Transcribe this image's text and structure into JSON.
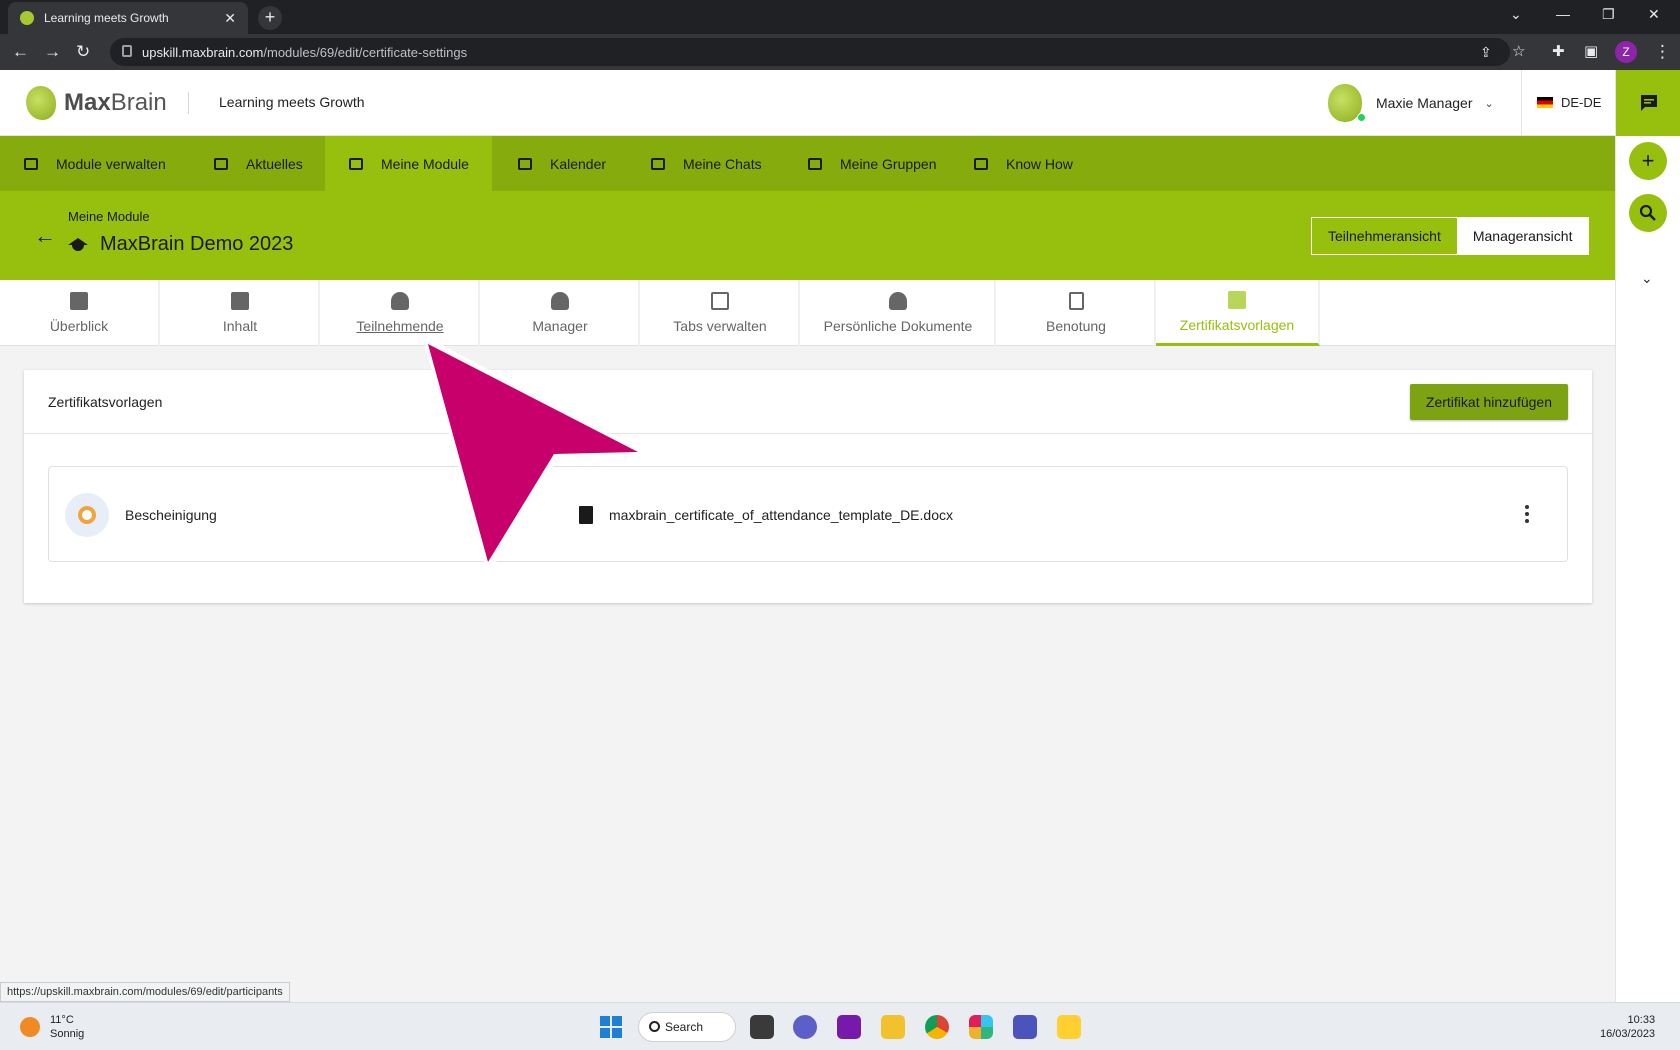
{
  "browser": {
    "tab_title": "Learning meets Growth",
    "tab_close": "✕",
    "new_tab": "+",
    "url_host": "upskill.maxbrain.com",
    "url_path": "/modules/69/edit/certificate-settings",
    "profile_initial": "Z"
  },
  "header": {
    "logo_bold": "Max",
    "logo_rest": "Brain",
    "tagline": "Learning meets Growth",
    "user_name": "Maxie Manager",
    "language": "DE-DE"
  },
  "nav": {
    "items": [
      {
        "label": "Module verwalten",
        "icon": "folder-user-icon"
      },
      {
        "label": "Aktuelles",
        "icon": "news-icon"
      },
      {
        "label": "Meine Module",
        "icon": "graduation-cap-icon"
      },
      {
        "label": "Kalender",
        "icon": "calendar-icon"
      },
      {
        "label": "Meine Chats",
        "icon": "inbox-icon"
      },
      {
        "label": "Meine Gruppen",
        "icon": "group-icon"
      },
      {
        "label": "Know How",
        "icon": "book-icon"
      }
    ]
  },
  "module": {
    "breadcrumb": "Meine Module",
    "title": "MaxBrain Demo 2023",
    "view_participant": "Teilnehmeransicht",
    "view_manager": "Manageransicht"
  },
  "tabs": [
    {
      "label": "Überblick",
      "icon": "dashboard-icon"
    },
    {
      "label": "Inhalt",
      "icon": "folder-icon"
    },
    {
      "label": "Teilnehmende",
      "icon": "people-icon"
    },
    {
      "label": "Manager",
      "icon": "manager-icon"
    },
    {
      "label": "Tabs verwalten",
      "icon": "window-icon"
    },
    {
      "label": "Persönliche Dokumente",
      "icon": "person-doc-icon"
    },
    {
      "label": "Benotung",
      "icon": "grade-doc-icon"
    },
    {
      "label": "Zertifikatsvorlagen",
      "icon": "certificate-settings-icon"
    }
  ],
  "certificates": {
    "section_title": "Zertifikatsvorlagen",
    "add_button": "Zertifikat hinzufügen",
    "rows": [
      {
        "name": "Bescheinigung",
        "file": "maxbrain_certificate_of_attendance_template_DE.docx"
      }
    ]
  },
  "status_url": "https://upskill.maxbrain.com/modules/69/edit/participants",
  "taskbar": {
    "temperature": "11°C",
    "weather": "Sonnig",
    "search_label": "Search",
    "time": "10:33",
    "date": "16/03/2023"
  },
  "colors": {
    "brand": "#97bf0d",
    "nav": "#86ab0d",
    "button": "#7ea312",
    "pointer": "#c8006b"
  }
}
